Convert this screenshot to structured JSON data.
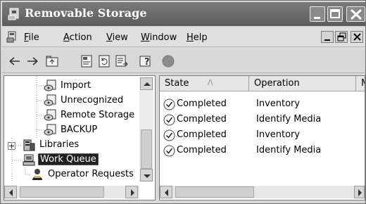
{
  "window": {
    "title": "Removable Storage"
  },
  "menu": {
    "items": [
      {
        "label": "File",
        "accel": "F",
        "rest": "ile"
      },
      {
        "label": "Action",
        "accel": "A",
        "rest": "ction"
      },
      {
        "label": "View",
        "accel": "V",
        "rest": "iew"
      },
      {
        "label": "Window",
        "accel": "W",
        "rest": "indow"
      },
      {
        "label": "Help",
        "accel": "H",
        "rest": "elp"
      }
    ]
  },
  "toolbar": {
    "icons": [
      "back-arrow-icon",
      "forward-arrow-icon",
      "up-folder-icon",
      "properties-icon",
      "refresh-icon",
      "export-list-icon",
      "help-icon",
      "status-circle-icon"
    ]
  },
  "tree": {
    "items": [
      {
        "label": "Import",
        "icon": "media-pool-icon"
      },
      {
        "label": "Unrecognized",
        "icon": "media-pool-icon"
      },
      {
        "label": "Remote Storage",
        "icon": "media-pool-icon"
      },
      {
        "label": "BACKUP",
        "icon": "media-pool-icon"
      },
      {
        "label": "Libraries",
        "icon": "libraries-icon",
        "expander": "+"
      },
      {
        "label": "Work Queue",
        "icon": "work-queue-icon",
        "selected": true
      },
      {
        "label": "Operator Requests",
        "icon": "operator-icon"
      }
    ]
  },
  "list": {
    "columns": [
      {
        "label": "State",
        "sort_indicator": "/\\"
      },
      {
        "label": "Operation"
      },
      {
        "label": "M"
      }
    ],
    "rows": [
      {
        "state": "Completed",
        "operation": "Inventory"
      },
      {
        "state": "Completed",
        "operation": "Identify Media"
      },
      {
        "state": "Completed",
        "operation": "Inventory"
      },
      {
        "state": "Completed",
        "operation": "Identify Media"
      }
    ]
  },
  "colors": {
    "titlebar": "#6a6a6a",
    "selection": "#202020",
    "status_dot": "#8c8c8c"
  }
}
